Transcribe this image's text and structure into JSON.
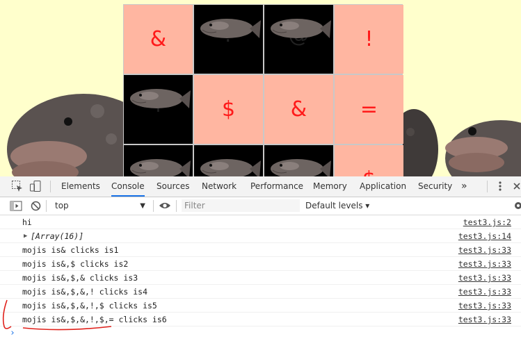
{
  "board": {
    "rows": [
      [
        {
          "state": "open",
          "symbol": "&"
        },
        {
          "state": "closed",
          "symbol": "?"
        },
        {
          "state": "closed",
          "symbol": "@"
        },
        {
          "state": "open",
          "symbol": "!"
        }
      ],
      [
        {
          "state": "closed",
          "symbol": "+"
        },
        {
          "state": "open",
          "symbol": "$"
        },
        {
          "state": "open",
          "symbol": "&"
        },
        {
          "state": "open",
          "symbol": "="
        }
      ],
      [
        {
          "state": "closed",
          "symbol": "#"
        },
        {
          "state": "closed",
          "symbol": "#"
        },
        {
          "state": "closed",
          "symbol": "?"
        },
        {
          "state": "open",
          "symbol": "$"
        }
      ]
    ]
  },
  "devtools": {
    "tabs": [
      "Elements",
      "Console",
      "Sources",
      "Network",
      "Performance",
      "Memory",
      "Application",
      "Security"
    ],
    "active_tab": "Console",
    "more_tabs": "»",
    "context": "top",
    "filter_placeholder": "Filter",
    "levels": "Default levels ▾"
  },
  "console": {
    "rows": [
      {
        "msg": "hi",
        "src": "test3.js:2"
      },
      {
        "msg": "[Array(16)]",
        "src": "test3.js:14",
        "expandable": true
      },
      {
        "msg": "mojis is& clicks is1",
        "src": "test3.js:33"
      },
      {
        "msg": "mojis is&,$ clicks is2",
        "src": "test3.js:33"
      },
      {
        "msg": "mojis is&,$,& clicks is3",
        "src": "test3.js:33"
      },
      {
        "msg": "mojis is&,$,&,! clicks is4",
        "src": "test3.js:33"
      },
      {
        "msg": "mojis is&,$,&,!,$ clicks is5",
        "src": "test3.js:33"
      },
      {
        "msg": "mojis is&,$,&,!,$,= clicks is6",
        "src": "test3.js:33"
      }
    ],
    "prompt": "›"
  },
  "colors": {
    "page_bg": "#ffffcc",
    "card_open": "#ffb6a1",
    "card_symbol": "#ff1a1a",
    "card_closed": "#000000",
    "accent": "#1a73e8",
    "annotation": "#e0201a"
  }
}
